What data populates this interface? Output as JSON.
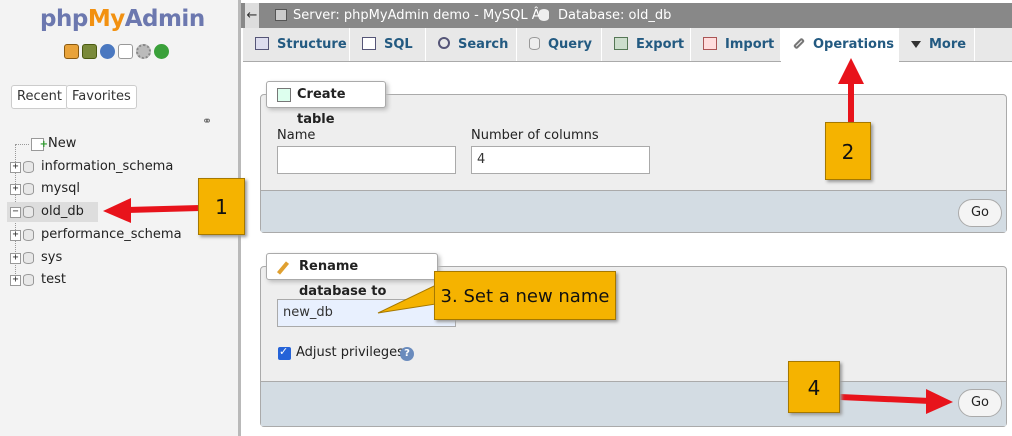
{
  "sidebar": {
    "logo": {
      "php": "php",
      "my": "My",
      "admin": "Admin"
    },
    "quick_icons": [
      "home-icon",
      "logout-icon",
      "help-icon",
      "docs-icon",
      "settings-icon",
      "reload-icon"
    ],
    "recent_label": "Recent",
    "favorites_label": "Favorites",
    "tree": [
      {
        "label": "New",
        "type": "new"
      },
      {
        "label": "information_schema",
        "type": "db"
      },
      {
        "label": "mysql",
        "type": "db"
      },
      {
        "label": "old_db",
        "type": "db",
        "expanded": true
      },
      {
        "label": "performance_schema",
        "type": "db"
      },
      {
        "label": "sys",
        "type": "db"
      },
      {
        "label": "test",
        "type": "db"
      }
    ]
  },
  "topbar": {
    "collapse": "←",
    "server": "Server: phpMyAdmin demo - MySQL  Â»",
    "database": "Database: old_db"
  },
  "tabs": [
    {
      "label": "Structure",
      "icon": "structure-icon"
    },
    {
      "label": "SQL",
      "icon": "sql-icon"
    },
    {
      "label": "Search",
      "icon": "search-icon"
    },
    {
      "label": "Query",
      "icon": "query-icon"
    },
    {
      "label": "Export",
      "icon": "export-icon"
    },
    {
      "label": "Import",
      "icon": "import-icon"
    },
    {
      "label": "Operations",
      "icon": "wrench-icon",
      "active": true
    },
    {
      "label": "More",
      "icon": "chevron-down-icon"
    }
  ],
  "create_table": {
    "legend": "Create table",
    "name_label": "Name",
    "name_value": "",
    "columns_label": "Number of columns",
    "columns_value": "4",
    "go_label": "Go"
  },
  "rename_db": {
    "legend": "Rename database to",
    "name_value": "new_db",
    "adjust_label": "Adjust privileges",
    "go_label": "Go"
  },
  "callouts": {
    "one": "1",
    "two": "2",
    "three": "3. Set a new name",
    "four": "4"
  },
  "colors": {
    "callout": "#f5b300",
    "arrow": "#e8131b",
    "tab_text": "#235a81"
  }
}
